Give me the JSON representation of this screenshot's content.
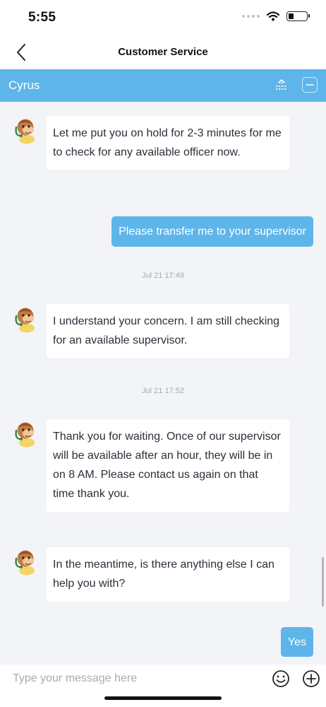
{
  "status_bar": {
    "time": "5:55",
    "battery_level": 0.3
  },
  "nav": {
    "title": "Customer Service",
    "back_icon": "chevron-left-icon"
  },
  "agent_bar": {
    "name": "Cyrus",
    "color": "#5eb5ea",
    "icons": [
      "transfer-icon",
      "minimize-icon"
    ]
  },
  "messages": [
    {
      "from": "agent",
      "text": "Let me put you on hold for 2-3 minutes for me to check for any available officer now."
    },
    {
      "from": "user",
      "text": "Please transfer me to your supervisor"
    },
    {
      "type": "timestamp",
      "text": "Jul 21 17:49"
    },
    {
      "from": "agent",
      "text": "I understand your concern. I am still checking for an available supervisor."
    },
    {
      "type": "timestamp",
      "text": "Jul 21 17:52"
    },
    {
      "from": "agent",
      "text": "Thank you for waiting. Once of our supervisor will be available after an hour, they will be in on 8 AM. Please contact us again on that time thank you."
    },
    {
      "from": "agent",
      "text": "In the meantime, is there anything else I can help you with?"
    },
    {
      "from": "user",
      "text": "Yes"
    }
  ],
  "composer": {
    "placeholder": "Type your message here",
    "icons": [
      "emoji-icon",
      "plus-icon"
    ]
  },
  "colors": {
    "accent": "#5eb5ea",
    "background": "#f3f4f8",
    "agent_bubble": "#ffffff"
  }
}
